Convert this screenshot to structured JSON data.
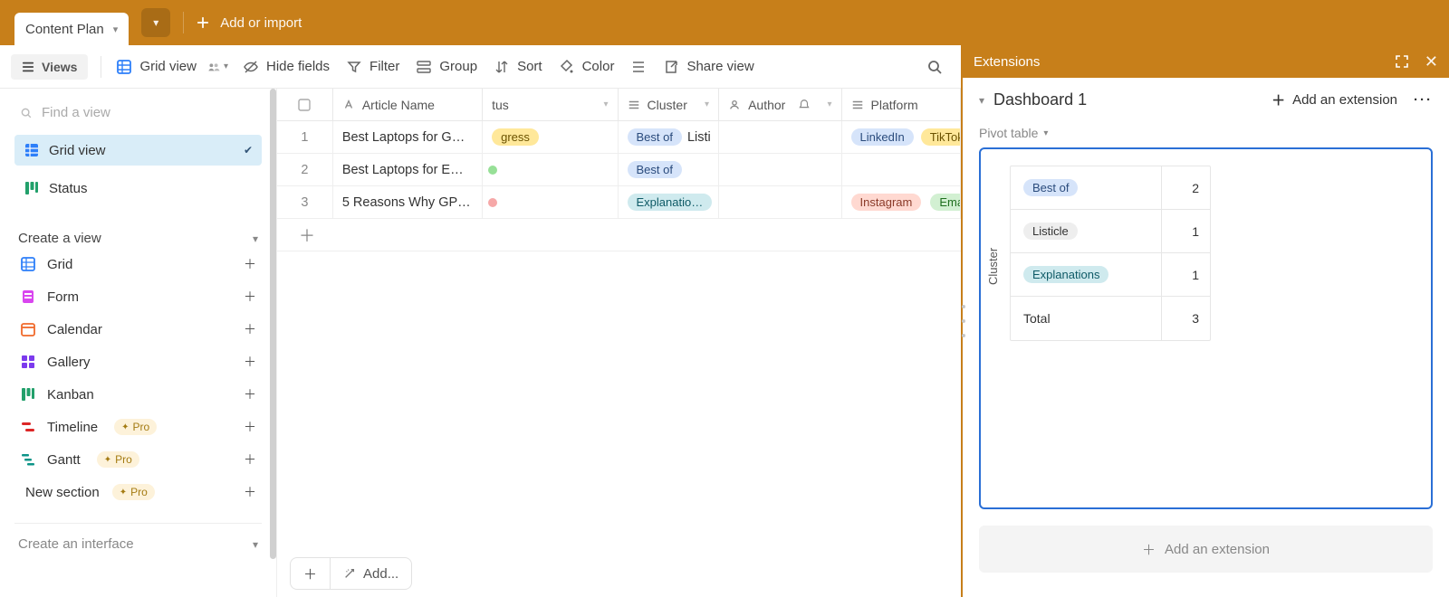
{
  "topbar": {
    "table_name": "Content Plan",
    "add_or_import": "Add or import"
  },
  "toolbar": {
    "views_label": "Views",
    "grid_view_label": "Grid view",
    "hide_fields": "Hide fields",
    "filter": "Filter",
    "group": "Group",
    "sort": "Sort",
    "color": "Color",
    "share_view": "Share view"
  },
  "sidebar": {
    "find_placeholder": "Find a view",
    "views": [
      {
        "label": "Grid view",
        "type": "grid",
        "active": true
      },
      {
        "label": "Status",
        "type": "kanban",
        "active": false
      }
    ],
    "create_view_label": "Create a view",
    "view_types": [
      {
        "label": "Grid",
        "icon": "grid",
        "pro": false
      },
      {
        "label": "Form",
        "icon": "form",
        "pro": false
      },
      {
        "label": "Calendar",
        "icon": "calendar",
        "pro": false
      },
      {
        "label": "Gallery",
        "icon": "gallery",
        "pro": false
      },
      {
        "label": "Kanban",
        "icon": "kanban",
        "pro": false
      },
      {
        "label": "Timeline",
        "icon": "timeline",
        "pro": true
      },
      {
        "label": "Gantt",
        "icon": "gantt",
        "pro": true
      }
    ],
    "new_section": "New section",
    "pro_label": "Pro",
    "create_interface": "Create an interface"
  },
  "grid": {
    "columns": {
      "article": "Article Name",
      "status": "tus",
      "cluster": "Cluster",
      "author": "Author",
      "platform": "Platform"
    },
    "rows": [
      {
        "num": "1",
        "article": "Best Laptops for G…",
        "status_tag": "gress",
        "status_class": "tag-inprogress",
        "cluster": [
          "Best of",
          "Listi"
        ],
        "author": "",
        "platform": [
          "LinkedIn",
          "TikTok"
        ]
      },
      {
        "num": "2",
        "article": "Best Laptops for E…",
        "status_dot": "green",
        "cluster": [
          "Best of"
        ],
        "author": "",
        "platform": []
      },
      {
        "num": "3",
        "article": "5 Reasons Why GP…",
        "status_dot": "red",
        "cluster": [
          "Explanatio…"
        ],
        "author": "",
        "platform": [
          "Instagram",
          "Emai"
        ]
      }
    ],
    "footer_add": "Add..."
  },
  "extensions": {
    "panel_title": "Extensions",
    "dashboard_title": "Dashboard 1",
    "add_extension": "Add an extension",
    "pivot_label": "Pivot table",
    "axis_label": "Cluster",
    "pivot_rows": [
      {
        "label": "Best of",
        "class": "tag-bestof",
        "value": "2"
      },
      {
        "label": "Listicle",
        "class": "tag-listicle",
        "value": "1"
      },
      {
        "label": "Explanations",
        "class": "tag-explain",
        "value": "1"
      }
    ],
    "total_label": "Total",
    "total_value": "3",
    "add_extension_big": "Add an extension"
  },
  "chart_data": {
    "type": "table",
    "title": "Pivot table",
    "row_dimension": "Cluster",
    "rows": [
      {
        "Cluster": "Best of",
        "count": 2
      },
      {
        "Cluster": "Listicle",
        "count": 1
      },
      {
        "Cluster": "Explanations",
        "count": 1
      }
    ],
    "total": 3
  }
}
